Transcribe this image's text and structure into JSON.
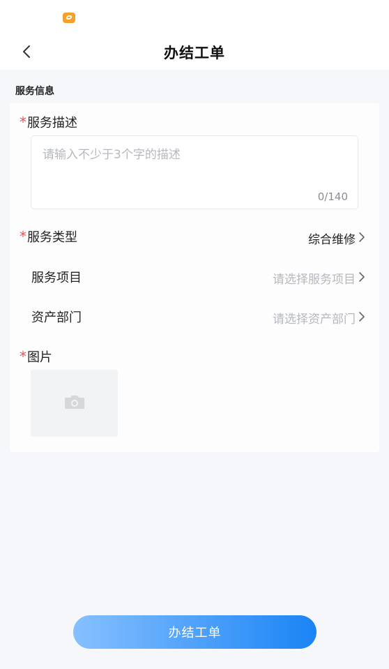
{
  "header": {
    "title": "办结工单"
  },
  "section": {
    "title": "服务信息"
  },
  "form": {
    "description": {
      "label": "服务描述",
      "placeholder": "请输入不少于3个字的描述",
      "counter": "0/140"
    },
    "service_type": {
      "label": "服务类型",
      "value": "综合维修"
    },
    "service_item": {
      "label": "服务项目",
      "placeholder": "请选择服务项目"
    },
    "asset_dept": {
      "label": "资产部门",
      "placeholder": "请选择资产部门"
    },
    "photo": {
      "label": "图片"
    },
    "required_mark": "*"
  },
  "submit": {
    "label": "办结工单"
  },
  "icons": {
    "status_app": "app-badge-icon",
    "back": "chevron-left-icon",
    "row_arrow": "chevron-right-icon",
    "camera": "camera-icon"
  },
  "colors": {
    "required": "#e25555",
    "button_start": "#86c0ff",
    "button_end": "#1a84f5",
    "placeholder": "#b5b8bd"
  }
}
